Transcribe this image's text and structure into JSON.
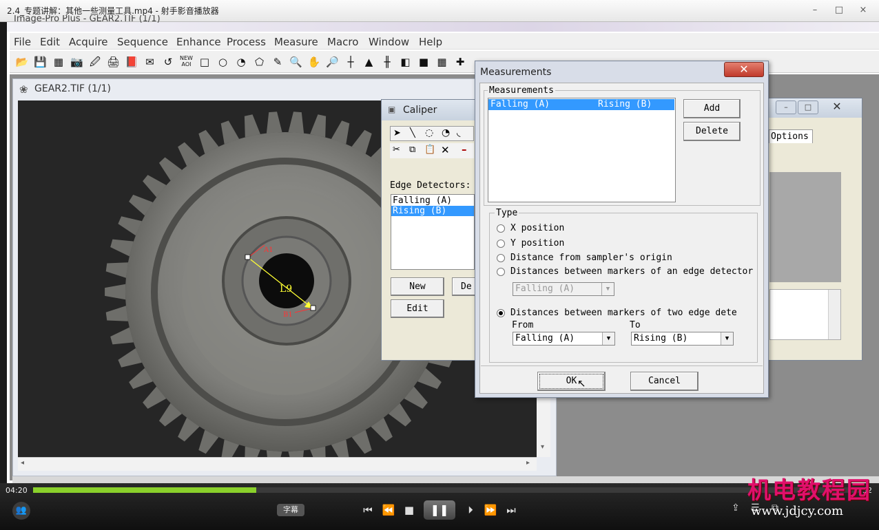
{
  "player": {
    "title": "2.4_专题讲解：其他一些测量工具.mp4 - 射手影音播放器",
    "min": "–",
    "max": "□",
    "close": "×",
    "time_left": "04:20",
    "time_right": "32",
    "progress": 0.27,
    "subtitle_label": "字幕",
    "watermark": "机电教程园",
    "watermark_url": "www.jdjcy.com",
    "controls": [
      "⏮",
      "⏪",
      "■",
      "⏵",
      "⏩",
      "⏭"
    ],
    "pause_glyph": "❚❚"
  },
  "app": {
    "title": "Image-Pro Plus - GEAR2.TIF (1/1)",
    "menu": [
      "File",
      "Edit",
      "Acquire",
      "Sequence",
      "Enhance",
      "Process",
      "Measure",
      "Macro",
      "Window",
      "Help"
    ],
    "toolbar": [
      "📂",
      "💾",
      "▦",
      "📷",
      "🖉",
      "🖨",
      "📕",
      "✉",
      "↺",
      "NEW AOI",
      "□",
      "○",
      "◔",
      "⬠",
      "✎",
      "🔍",
      "✋",
      "🔎",
      "┼",
      "▲",
      "╫",
      "◧",
      "■",
      "▦",
      "✚"
    ]
  },
  "image_window": {
    "title": "GEAR2.TIF (1/1)",
    "markers": {
      "a": "A1",
      "b": "B1",
      "line": "L9"
    }
  },
  "caliper": {
    "title": "Caliper",
    "edge_label": "Edge Detectors:",
    "items": [
      "Falling (A)",
      "Rising  (B)"
    ],
    "selected": 1,
    "new": "New",
    "delete": "De",
    "edit": "Edit"
  },
  "options": {
    "tab": "Options"
  },
  "measurements": {
    "title": "Measurements",
    "close": "✕",
    "group_label": "Measurements",
    "list": [
      {
        "from": "Falling (A)",
        "to": "Rising (B)"
      }
    ],
    "add": "Add",
    "delete": "Delete",
    "type_label": "Type",
    "types": [
      "X position",
      "Y position",
      "Distance from sampler's origin",
      "Distances between markers of an edge detector",
      "Distances between markers of two edge dete"
    ],
    "selected_type": 4,
    "single_combo": "Falling (A)",
    "from_label": "From",
    "to_label": "To",
    "from_value": "Falling (A)",
    "to_value": "Rising (B)",
    "ok": "OK",
    "cancel": "Cancel"
  }
}
